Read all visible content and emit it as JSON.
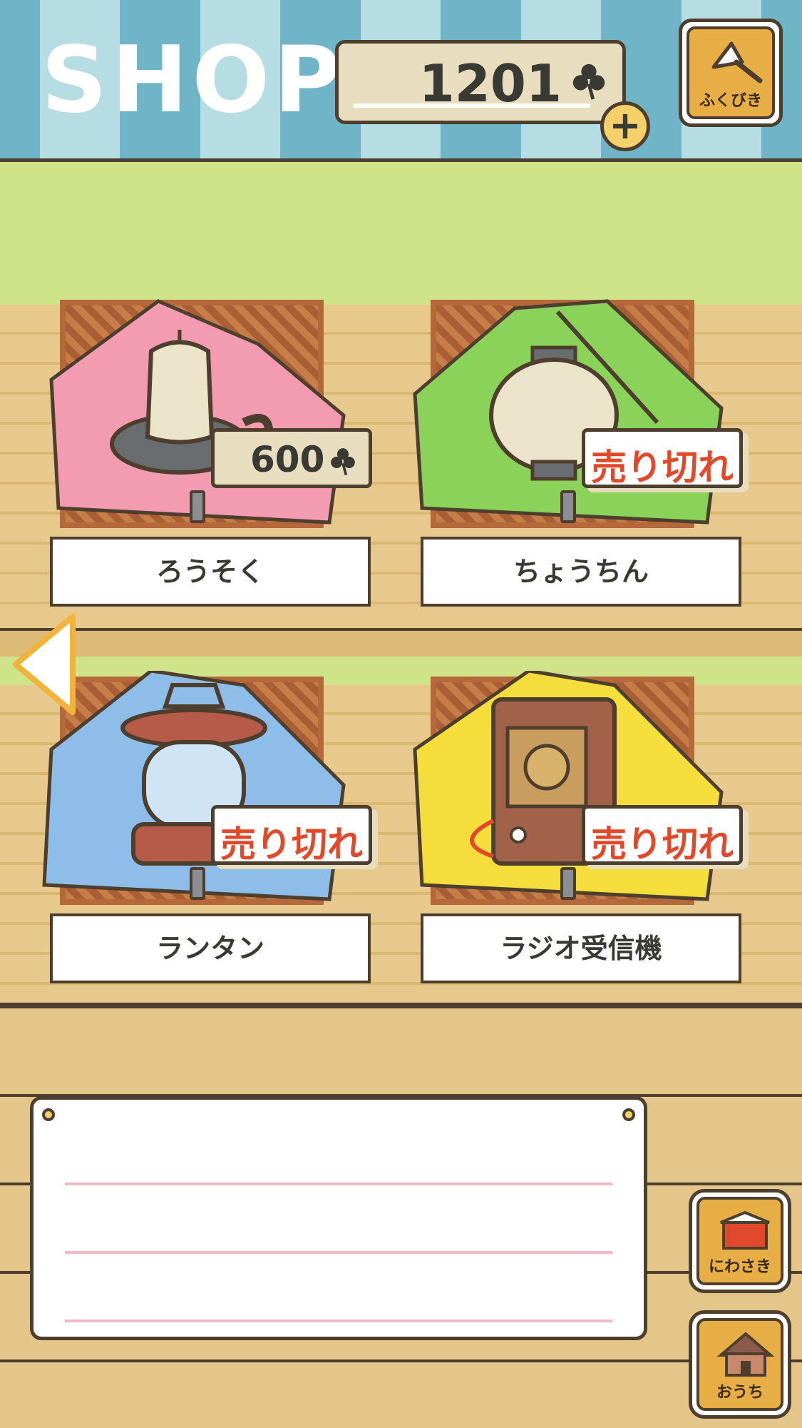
{
  "header": {
    "title": "SHOP",
    "clover_count": "1201",
    "add_clovers_symbol": "+",
    "lottery_label": "ふくびき"
  },
  "items": [
    {
      "name": "ろうそく",
      "tag": "600",
      "tag_type": "price",
      "cloth_color": "#f39bb1"
    },
    {
      "name": "ちょうちん",
      "tag": "売り切れ",
      "tag_type": "sold",
      "cloth_color": "#8bd25a"
    },
    {
      "name": "ランタン",
      "tag": "売り切れ",
      "tag_type": "sold",
      "cloth_color": "#8dbde8"
    },
    {
      "name": "ラジオ受信機",
      "tag": "売り切れ",
      "tag_type": "sold",
      "cloth_color": "#f5dd3c"
    }
  ],
  "nav": {
    "garden_label": "にわさき",
    "home_label": "おうち"
  },
  "colors": {
    "outline": "#4e3e2e",
    "sold_red": "#e04a2a",
    "wall_green": "#cfe388",
    "wood": "#e7c98e"
  }
}
